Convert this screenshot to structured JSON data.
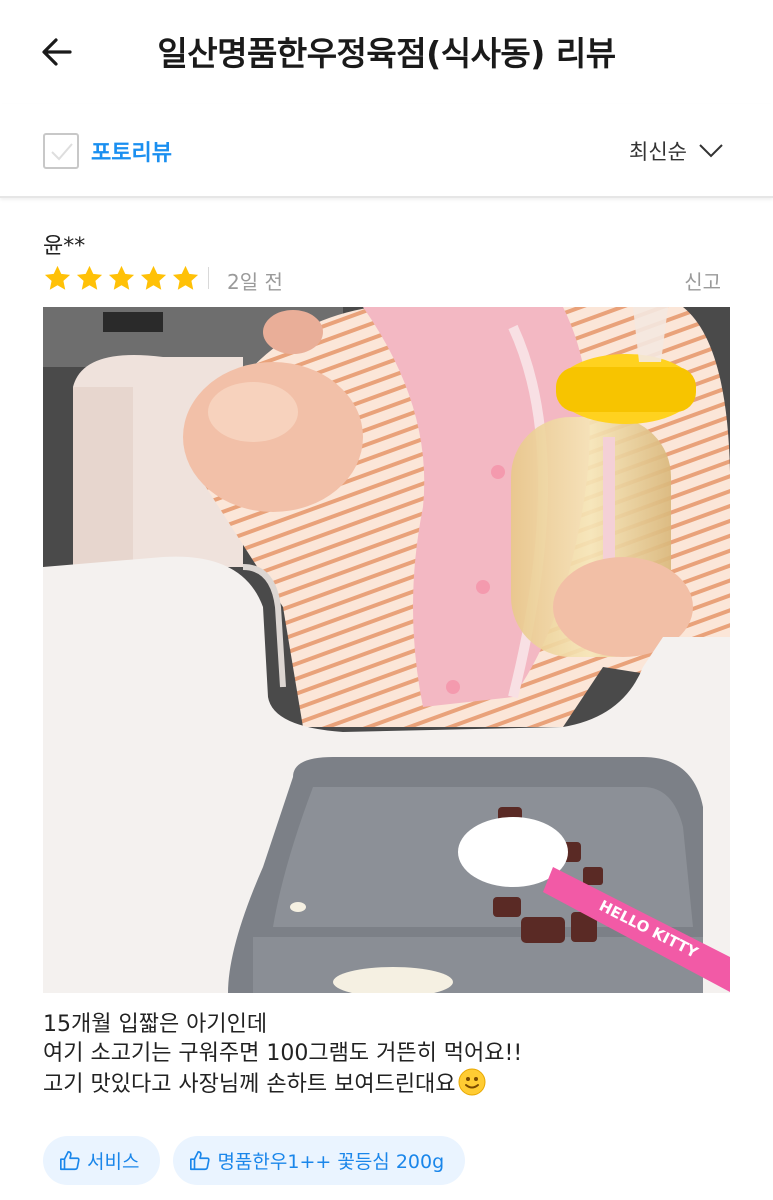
{
  "header": {
    "title": "일산명품한우정육점(식사동) 리뷰"
  },
  "filter": {
    "photo_review_label": "포토리뷰",
    "photo_review_checked": false,
    "sort_label": "최신순"
  },
  "review": {
    "author": "윤**",
    "rating": 5,
    "rating_max": 5,
    "date": "2일 전",
    "report_label": "신고",
    "body_lines": [
      "15개월 입짧은 아기인데",
      "여기 소고기는 구워주면 100그램도 거뜬히 먹어요!!",
      "고기 맛있다고 사장님께 손하트 보여드린대요"
    ],
    "tags": [
      {
        "label": "서비스"
      },
      {
        "label": "명품한우1++ 꽃등심 200g"
      }
    ]
  },
  "colors": {
    "accent": "#1a8ff0",
    "star": "#ffc107",
    "tag_bg": "#eaf4ff"
  },
  "icons": {
    "back": "arrow-left-icon",
    "sort": "chevron-down-icon",
    "tag": "thumbs-up-icon",
    "emoji": "smiley-emoji-icon"
  }
}
